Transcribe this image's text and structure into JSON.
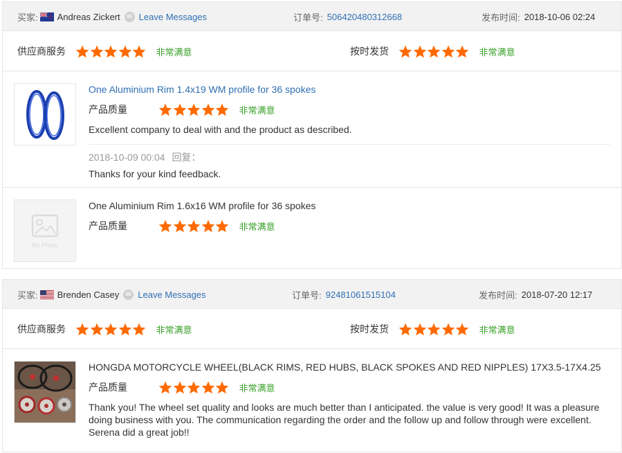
{
  "colors": {
    "star": "#ff6a00",
    "satisfied": "#3aa12a",
    "link": "#2f6fb3",
    "header_bg": "#f2f2f2"
  },
  "reviews": [
    {
      "buyer_label": "买家:",
      "buyer_name": "Andreas Zickert",
      "buyer_flag": "nz-flag",
      "leave_messages": "Leave Messages",
      "order_label": "订单号:",
      "order_no": "506420480312668",
      "date_label": "发布时间:",
      "date": "2018-10-06 02:24",
      "supplier_service_label": "供应商服务",
      "supplier_service_rating": 5,
      "supplier_service_text": "非常满意",
      "on_time_label": "按时发货",
      "on_time_rating": 5,
      "on_time_text": "非常满意",
      "items": [
        {
          "title": "One Aluminium Rim 1.4x19 WM profile for 36 spokes",
          "quality_label": "产品质量",
          "quality_rating": 5,
          "quality_text": "非常满意",
          "feedback": "Excellent company to deal with and the product as described.",
          "reply_time": "2018-10-09 00:04",
          "reply_label": "回复：",
          "reply_text": "Thanks for your kind feedback."
        },
        {
          "title": "One Aluminium Rim 1.6x16 WM profile for 36 spokes",
          "quality_label": "产品质量",
          "quality_rating": 5,
          "quality_text": "非常满意",
          "thumb_placeholder": "No Photo"
        }
      ]
    },
    {
      "buyer_label": "买家:",
      "buyer_name": "Brenden Casey",
      "buyer_flag": "us-flag",
      "leave_messages": "Leave Messages",
      "order_label": "订单号:",
      "order_no": "92481061515104",
      "date_label": "发布时间:",
      "date": "2018-07-20 12:17",
      "supplier_service_label": "供应商服务",
      "supplier_service_rating": 5,
      "supplier_service_text": "非常满意",
      "on_time_label": "按时发货",
      "on_time_rating": 5,
      "on_time_text": "非常满意",
      "items": [
        {
          "title": "HONGDA MOTORCYCLE WHEEL(BLACK RIMS, RED HUBS, BLACK SPOKES AND RED NIPPLES) 17X3.5-17X4.25",
          "quality_label": "产品质量",
          "quality_rating": 5,
          "quality_text": "非常满意",
          "feedback": "Thank you! The wheel set quality and looks are much better than I anticipated. the value is very good! It was a pleasure doing business with you. The communication regarding the order and the follow up and follow through were excellent. Serena did a great job!!"
        }
      ]
    }
  ]
}
